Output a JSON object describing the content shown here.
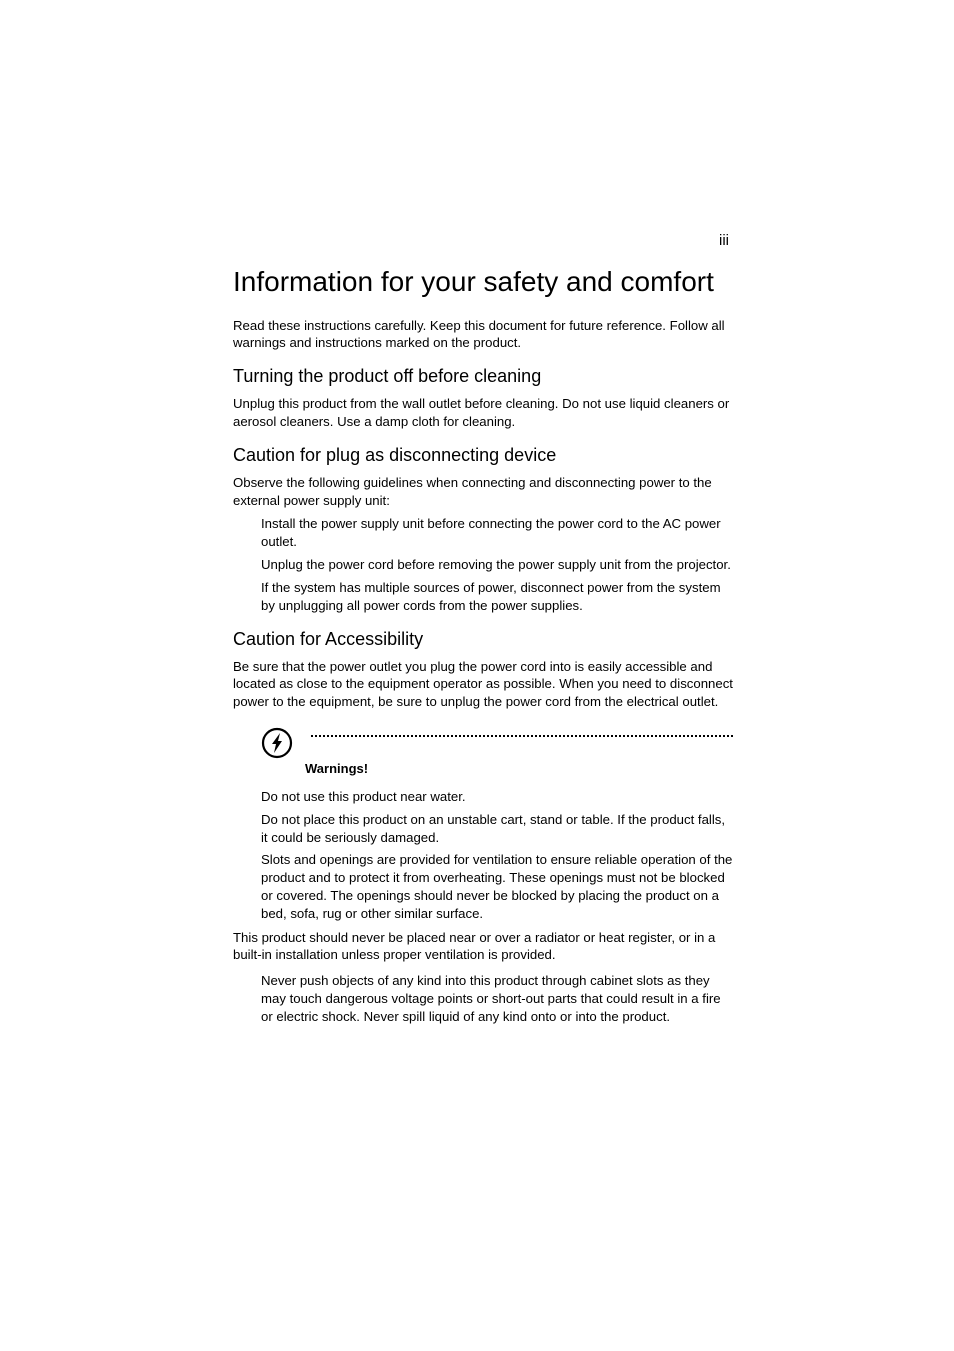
{
  "page_number": "iii",
  "title": "Information for your safety and comfort",
  "intro": "Read these instructions carefully. Keep this document for future reference. Follow all warnings and instructions marked on the product.",
  "section1": {
    "heading": "Turning the product off before cleaning",
    "body": "Unplug this product from the wall outlet before cleaning. Do not use liquid cleaners or aerosol cleaners. Use a damp cloth for cleaning."
  },
  "section2": {
    "heading": "Caution for plug as disconnecting device",
    "intro": "Observe the following guidelines when connecting and disconnecting power to the external power supply unit:",
    "bullets": [
      "Install the power supply unit before connecting the power cord to the AC power outlet.",
      "Unplug the power cord before removing the power supply unit from the projector.",
      "If the system has multiple sources of power, disconnect power from the system by unplugging all power cords from the power supplies."
    ]
  },
  "section3": {
    "heading": "Caution for Accessibility",
    "body": "Be sure that the power outlet you plug the power cord into is easily accessible and located as close to the equipment operator as possible. When you need to disconnect power to the equipment, be sure to unplug the power cord from the electrical outlet.",
    "warnings_label": "Warnings!",
    "bullets1": [
      "Do not use this product near water.",
      "Do not place this product on an unstable cart, stand or table. If the product falls, it could be seriously damaged.",
      "Slots and openings are provided for ventilation to ensure reliable operation of the product and to protect it from overheating. These openings must not be blocked or covered. The openings should never be blocked by placing the product on a bed, sofa, rug or other similar surface."
    ],
    "mid_para": "This product should never be placed near or over a radiator or heat register, or in a built-in installation unless proper ventilation is provided.",
    "bullets2": [
      "Never push objects of any kind into this product through cabinet slots as they may touch dangerous voltage points or short-out parts that could result in a fire or electric shock. Never spill liquid of any kind onto or into the product."
    ]
  }
}
